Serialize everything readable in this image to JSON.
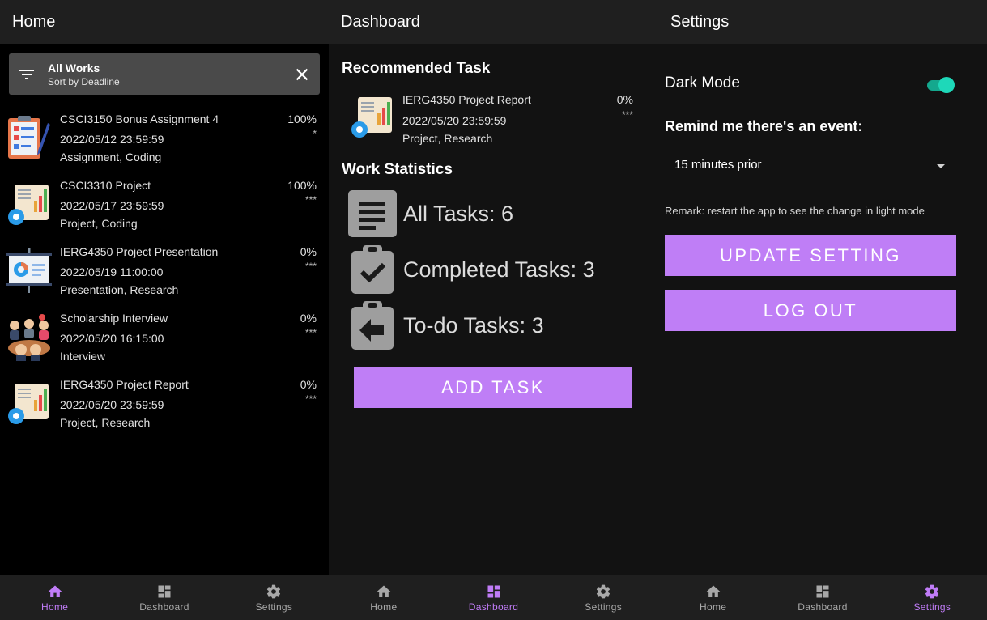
{
  "home": {
    "title": "Home",
    "filter": {
      "title": "All Works",
      "subtitle": "Sort by Deadline",
      "icon": "filter-icon",
      "close_icon": "close-icon"
    },
    "tasks": [
      {
        "name": "CSCI3150 Bonus Assignment 4",
        "date": "2022/05/12 23:59:59",
        "tags": "Assignment, Coding",
        "progress": "100%",
        "priority": "*",
        "icon": "assignment-icon"
      },
      {
        "name": "CSCI3310 Project",
        "date": "2022/05/17 23:59:59",
        "tags": "Project, Coding",
        "progress": "100%",
        "priority": "***",
        "icon": "project-report-icon"
      },
      {
        "name": "IERG4350 Project Presentation",
        "date": "2022/05/19 11:00:00",
        "tags": "Presentation, Research",
        "progress": "0%",
        "priority": "***",
        "icon": "presentation-icon"
      },
      {
        "name": "Scholarship Interview",
        "date": "2022/05/20 16:15:00",
        "tags": "Interview",
        "progress": "0%",
        "priority": "***",
        "icon": "interview-icon"
      },
      {
        "name": "IERG4350 Project Report",
        "date": "2022/05/20 23:59:59",
        "tags": "Project, Research",
        "progress": "0%",
        "priority": "***",
        "icon": "project-report-icon"
      }
    ]
  },
  "dashboard": {
    "title": "Dashboard",
    "recommended_title": "Recommended Task",
    "recommended": {
      "name": "IERG4350 Project Report",
      "date": "2022/05/20 23:59:59",
      "tags": "Project, Research",
      "progress": "0%",
      "priority": "***"
    },
    "stats_title": "Work Statistics",
    "stats": {
      "all": "All Tasks: 6",
      "completed": "Completed Tasks: 3",
      "todo": "To-do Tasks: 3"
    },
    "add_button": "ADD TASK"
  },
  "settings": {
    "title": "Settings",
    "dark_mode_label": "Dark Mode",
    "dark_mode_on": true,
    "remind_label": "Remind me there's an event:",
    "remind_value": "15 minutes prior",
    "remark": "Remark: restart the app to see the change in light mode",
    "update_button": "UPDATE SETTING",
    "logout_button": "LOG OUT"
  },
  "nav": {
    "home": "Home",
    "dashboard": "Dashboard",
    "settings": "Settings"
  },
  "colors": {
    "accent": "#bf7ef6",
    "nav_active": "#c07cf7",
    "toggle": "#1ed8b9",
    "appbar": "#1f1f1f"
  }
}
